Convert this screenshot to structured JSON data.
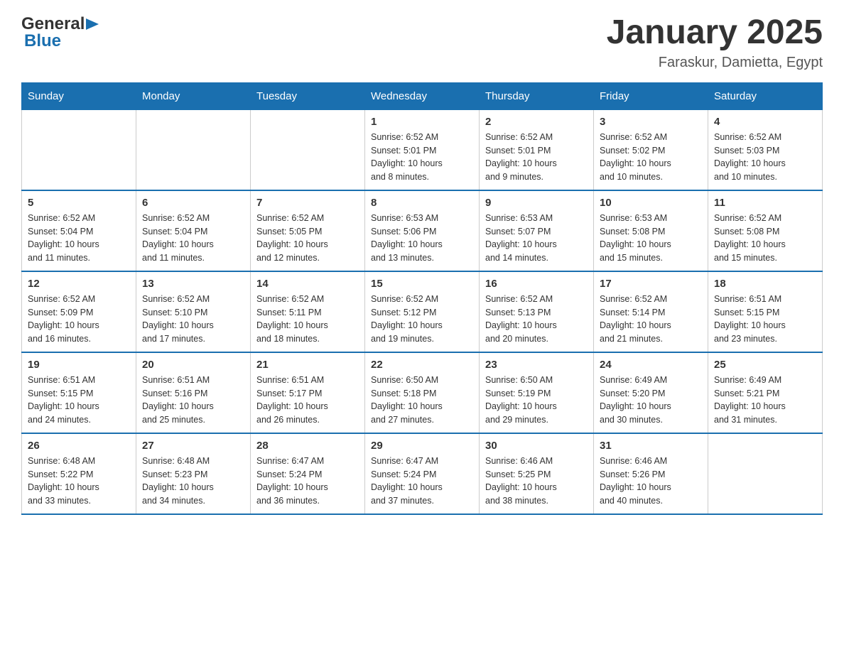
{
  "header": {
    "logo_general": "General",
    "logo_blue": "Blue",
    "month_title": "January 2025",
    "location": "Faraskur, Damietta, Egypt"
  },
  "days_of_week": [
    "Sunday",
    "Monday",
    "Tuesday",
    "Wednesday",
    "Thursday",
    "Friday",
    "Saturday"
  ],
  "weeks": [
    [
      {
        "day": "",
        "info": ""
      },
      {
        "day": "",
        "info": ""
      },
      {
        "day": "",
        "info": ""
      },
      {
        "day": "1",
        "info": "Sunrise: 6:52 AM\nSunset: 5:01 PM\nDaylight: 10 hours\nand 8 minutes."
      },
      {
        "day": "2",
        "info": "Sunrise: 6:52 AM\nSunset: 5:01 PM\nDaylight: 10 hours\nand 9 minutes."
      },
      {
        "day": "3",
        "info": "Sunrise: 6:52 AM\nSunset: 5:02 PM\nDaylight: 10 hours\nand 10 minutes."
      },
      {
        "day": "4",
        "info": "Sunrise: 6:52 AM\nSunset: 5:03 PM\nDaylight: 10 hours\nand 10 minutes."
      }
    ],
    [
      {
        "day": "5",
        "info": "Sunrise: 6:52 AM\nSunset: 5:04 PM\nDaylight: 10 hours\nand 11 minutes."
      },
      {
        "day": "6",
        "info": "Sunrise: 6:52 AM\nSunset: 5:04 PM\nDaylight: 10 hours\nand 11 minutes."
      },
      {
        "day": "7",
        "info": "Sunrise: 6:52 AM\nSunset: 5:05 PM\nDaylight: 10 hours\nand 12 minutes."
      },
      {
        "day": "8",
        "info": "Sunrise: 6:53 AM\nSunset: 5:06 PM\nDaylight: 10 hours\nand 13 minutes."
      },
      {
        "day": "9",
        "info": "Sunrise: 6:53 AM\nSunset: 5:07 PM\nDaylight: 10 hours\nand 14 minutes."
      },
      {
        "day": "10",
        "info": "Sunrise: 6:53 AM\nSunset: 5:08 PM\nDaylight: 10 hours\nand 15 minutes."
      },
      {
        "day": "11",
        "info": "Sunrise: 6:52 AM\nSunset: 5:08 PM\nDaylight: 10 hours\nand 15 minutes."
      }
    ],
    [
      {
        "day": "12",
        "info": "Sunrise: 6:52 AM\nSunset: 5:09 PM\nDaylight: 10 hours\nand 16 minutes."
      },
      {
        "day": "13",
        "info": "Sunrise: 6:52 AM\nSunset: 5:10 PM\nDaylight: 10 hours\nand 17 minutes."
      },
      {
        "day": "14",
        "info": "Sunrise: 6:52 AM\nSunset: 5:11 PM\nDaylight: 10 hours\nand 18 minutes."
      },
      {
        "day": "15",
        "info": "Sunrise: 6:52 AM\nSunset: 5:12 PM\nDaylight: 10 hours\nand 19 minutes."
      },
      {
        "day": "16",
        "info": "Sunrise: 6:52 AM\nSunset: 5:13 PM\nDaylight: 10 hours\nand 20 minutes."
      },
      {
        "day": "17",
        "info": "Sunrise: 6:52 AM\nSunset: 5:14 PM\nDaylight: 10 hours\nand 21 minutes."
      },
      {
        "day": "18",
        "info": "Sunrise: 6:51 AM\nSunset: 5:15 PM\nDaylight: 10 hours\nand 23 minutes."
      }
    ],
    [
      {
        "day": "19",
        "info": "Sunrise: 6:51 AM\nSunset: 5:15 PM\nDaylight: 10 hours\nand 24 minutes."
      },
      {
        "day": "20",
        "info": "Sunrise: 6:51 AM\nSunset: 5:16 PM\nDaylight: 10 hours\nand 25 minutes."
      },
      {
        "day": "21",
        "info": "Sunrise: 6:51 AM\nSunset: 5:17 PM\nDaylight: 10 hours\nand 26 minutes."
      },
      {
        "day": "22",
        "info": "Sunrise: 6:50 AM\nSunset: 5:18 PM\nDaylight: 10 hours\nand 27 minutes."
      },
      {
        "day": "23",
        "info": "Sunrise: 6:50 AM\nSunset: 5:19 PM\nDaylight: 10 hours\nand 29 minutes."
      },
      {
        "day": "24",
        "info": "Sunrise: 6:49 AM\nSunset: 5:20 PM\nDaylight: 10 hours\nand 30 minutes."
      },
      {
        "day": "25",
        "info": "Sunrise: 6:49 AM\nSunset: 5:21 PM\nDaylight: 10 hours\nand 31 minutes."
      }
    ],
    [
      {
        "day": "26",
        "info": "Sunrise: 6:48 AM\nSunset: 5:22 PM\nDaylight: 10 hours\nand 33 minutes."
      },
      {
        "day": "27",
        "info": "Sunrise: 6:48 AM\nSunset: 5:23 PM\nDaylight: 10 hours\nand 34 minutes."
      },
      {
        "day": "28",
        "info": "Sunrise: 6:47 AM\nSunset: 5:24 PM\nDaylight: 10 hours\nand 36 minutes."
      },
      {
        "day": "29",
        "info": "Sunrise: 6:47 AM\nSunset: 5:24 PM\nDaylight: 10 hours\nand 37 minutes."
      },
      {
        "day": "30",
        "info": "Sunrise: 6:46 AM\nSunset: 5:25 PM\nDaylight: 10 hours\nand 38 minutes."
      },
      {
        "day": "31",
        "info": "Sunrise: 6:46 AM\nSunset: 5:26 PM\nDaylight: 10 hours\nand 40 minutes."
      },
      {
        "day": "",
        "info": ""
      }
    ]
  ]
}
